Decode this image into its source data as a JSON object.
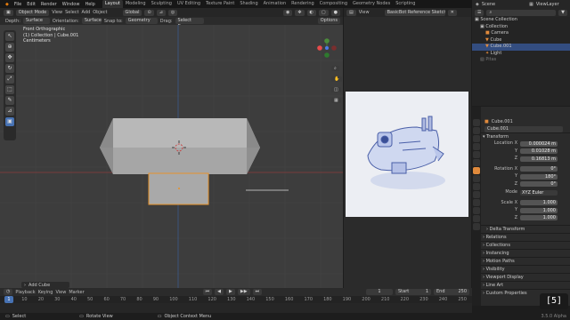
{
  "menu": {
    "items": [
      "File",
      "Edit",
      "Render",
      "Window",
      "Help"
    ]
  },
  "workspaces": {
    "tabs": [
      "Layout",
      "Modeling",
      "Sculpting",
      "UV Editing",
      "Texture Paint",
      "Shading",
      "Animation",
      "Rendering",
      "Compositing",
      "Geometry Nodes",
      "Scripting"
    ]
  },
  "scene": {
    "scene_label": "Scene",
    "viewlayer_label": "ViewLayer"
  },
  "viewport_header": {
    "mode": "Object Mode",
    "view": "View",
    "select": "Select",
    "add": "Add",
    "object": "Object",
    "transform": "Global"
  },
  "viewport_header2": {
    "depth_label": "Depth:",
    "depth_value": "Surface",
    "orientation_label": "Orientation:",
    "orientation_value": "Surface",
    "snap_label": "Snap to:",
    "snap_value": "Geometry",
    "drag_label": "Drag:",
    "drag_value": "Select Box",
    "options": "Options"
  },
  "viewport": {
    "view_name": "Front Orthographic",
    "collection_line": "(1) Collection | Cube.001",
    "units": "Centimeters",
    "last_op": "Add Cube"
  },
  "image_editor": {
    "view": "View",
    "image_name": "BasicBot Reference Sketch.jpg"
  },
  "outliner": {
    "title": "Scene Collection",
    "items": [
      {
        "label": "Collection",
        "indent": 1
      },
      {
        "label": "Camera",
        "indent": 2
      },
      {
        "label": "Cube",
        "indent": 2
      },
      {
        "label": "Cube.001",
        "indent": 2,
        "selected": true
      },
      {
        "label": "Light",
        "indent": 2
      },
      {
        "label": "Pitas",
        "indent": 1
      }
    ]
  },
  "properties": {
    "object_name": "Cube.001",
    "object_field": "Cube.001",
    "transform_label": "Transform",
    "location": {
      "label": "Location X",
      "y": "Y",
      "z": "Z",
      "x_val": "0.000024 m",
      "y_val": "0.01028 m",
      "z_val": "0.16813 m"
    },
    "rotation": {
      "label": "Rotation X",
      "y": "Y",
      "z": "Z",
      "x_val": "0°",
      "y_val": "180°",
      "z_val": "0°"
    },
    "mode": {
      "label": "Mode",
      "value": "XYZ Euler"
    },
    "scale": {
      "label": "Scale X",
      "y": "Y",
      "z": "Z",
      "x_val": "1.000",
      "y_val": "1.000",
      "z_val": "1.000"
    },
    "sections": [
      "Delta Transform",
      "Relations",
      "Collections",
      "Instancing",
      "Motion Paths",
      "Visibility",
      "Viewport Display",
      "Line Art",
      "Custom Properties"
    ]
  },
  "timeline": {
    "playback": "Playback",
    "keying": "Keying",
    "view": "View",
    "marker": "Marker",
    "current_frame": "1",
    "start_label": "Start",
    "start": "1",
    "end_label": "End",
    "end": "250",
    "ticks": [
      "0",
      "10",
      "20",
      "30",
      "40",
      "50",
      "60",
      "70",
      "80",
      "90",
      "100",
      "110",
      "120",
      "130",
      "140",
      "150",
      "160",
      "170",
      "180",
      "190",
      "200",
      "210",
      "220",
      "230",
      "240",
      "250"
    ]
  },
  "status": {
    "select": "Select",
    "rotate": "Rotate View",
    "context": "Object Context Menu",
    "version": "3.5.0 Alpha"
  },
  "badge": {
    "text": "[5]"
  }
}
